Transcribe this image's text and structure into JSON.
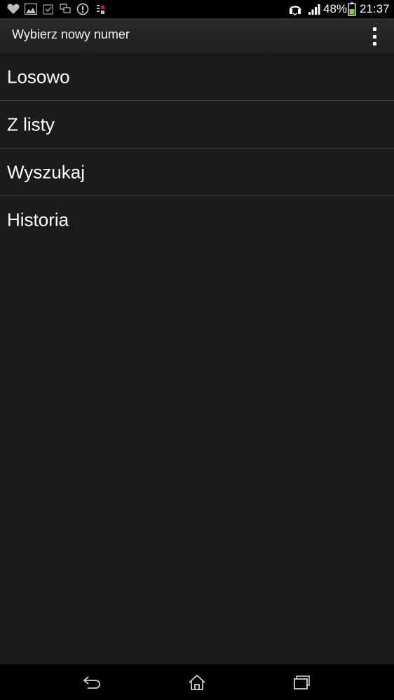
{
  "status_bar": {
    "left_icons": [
      "heart-icon",
      "gallery-icon",
      "checkbox-icon",
      "multiwindow-icon",
      "shield-alert-icon",
      "sim-icon"
    ],
    "right_icons": [
      "headset-icon",
      "signal-icon",
      "battery-icon"
    ],
    "battery": "48%",
    "time": "21:37"
  },
  "action_bar": {
    "title": "Wybierz nowy numer",
    "overflow_icon": "overflow-menu-icon"
  },
  "list": {
    "items": [
      {
        "label": "Losowo"
      },
      {
        "label": "Z listy"
      },
      {
        "label": "Wyszukaj"
      },
      {
        "label": "Historia"
      }
    ]
  },
  "nav_bar": {
    "buttons": [
      "back-icon",
      "home-icon",
      "recent-apps-icon"
    ]
  },
  "colors": {
    "background": "#1b1b1b",
    "divider": "#3d3d3d",
    "text": "#ffffff"
  }
}
